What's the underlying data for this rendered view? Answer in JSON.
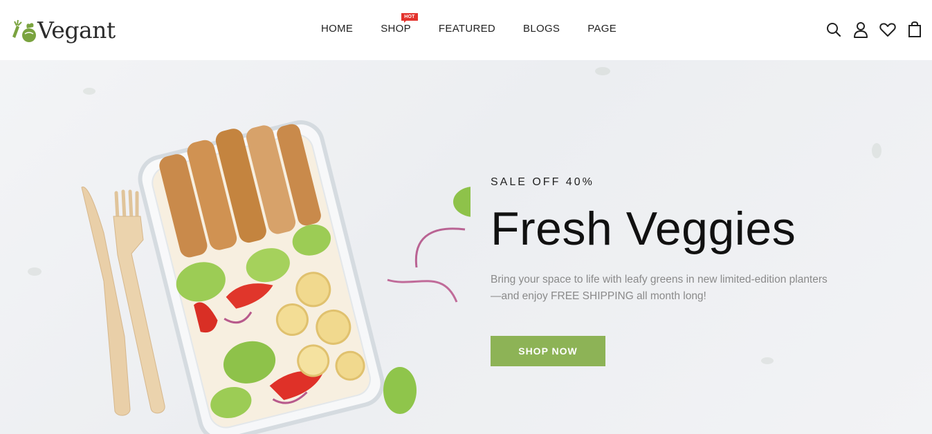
{
  "brand": {
    "name": "Vegant"
  },
  "nav": {
    "items": [
      {
        "label": "HOME"
      },
      {
        "label": "SHOP",
        "badge": "HOT"
      },
      {
        "label": "FEATURED"
      },
      {
        "label": "BLOGS"
      },
      {
        "label": "PAGE"
      }
    ]
  },
  "header_icons": [
    "search-icon",
    "user-icon",
    "heart-icon",
    "shopping-bag-icon"
  ],
  "hero": {
    "sale": "SALE OFF 40%",
    "title": "Fresh Veggies",
    "description": "Bring your space to life with leafy greens in new limited-edition planters—and enjoy FREE SHIPPING all month long!",
    "button_label": "SHOP NOW"
  },
  "colors": {
    "accent": "#8db356",
    "badge": "#e3332d",
    "text": "#111111",
    "muted": "#8a8a8a"
  }
}
